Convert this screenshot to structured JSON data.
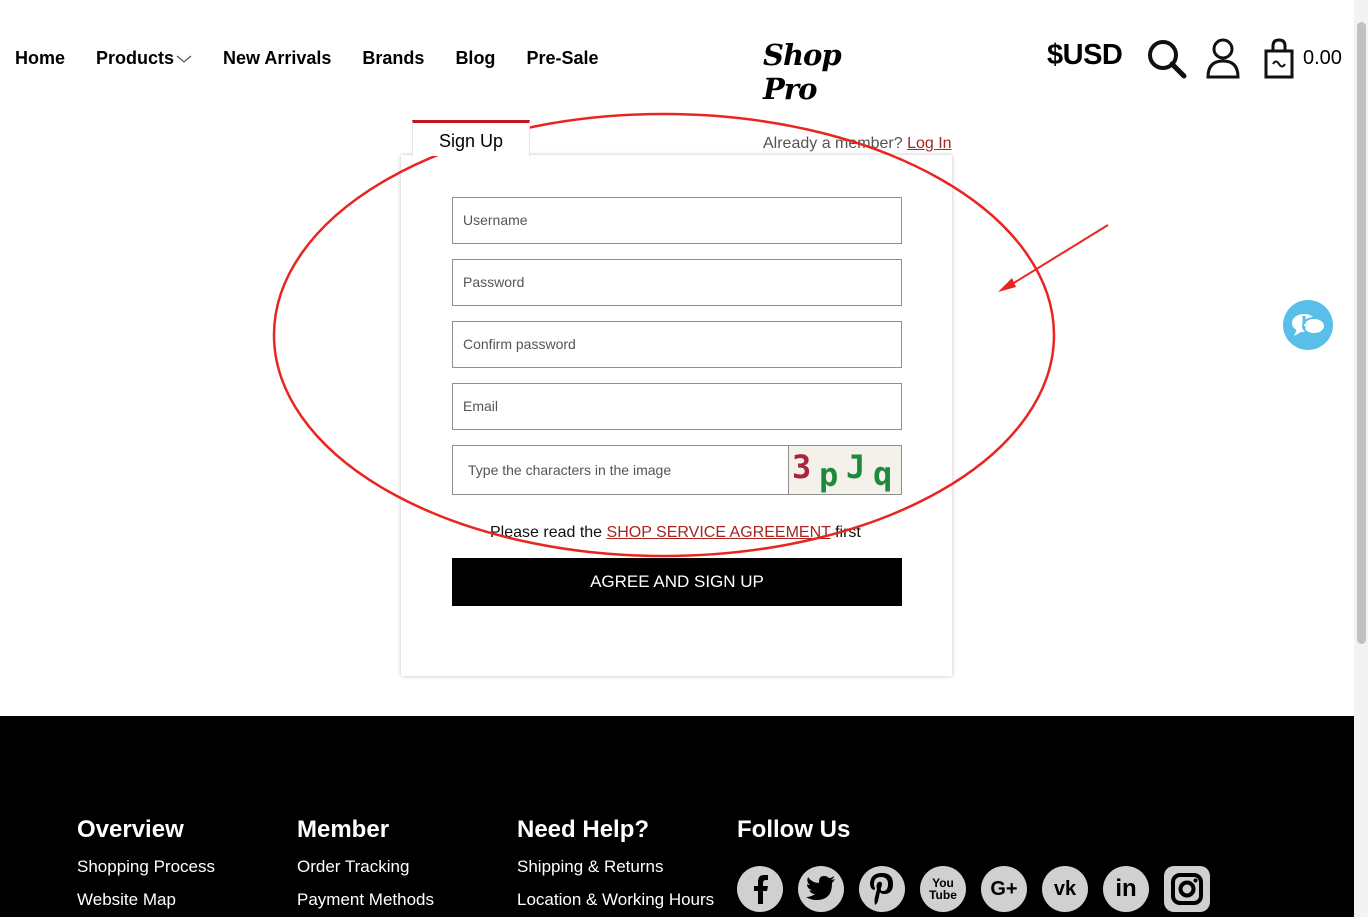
{
  "header": {
    "nav": [
      "Home",
      "Products",
      "New Arrivals",
      "Brands",
      "Blog",
      "Pre-Sale"
    ],
    "logo_text": "Shop Pro",
    "currency": "$USD",
    "cart_total": "0.00"
  },
  "signup": {
    "tab_label": "Sign Up",
    "already_member": "Already a member?",
    "login_link": "Log In",
    "fields": {
      "username": "Username",
      "password": "Password",
      "confirm_password": "Confirm password",
      "email": "Email",
      "captcha": "Type the characters in the image"
    },
    "captcha_chars": [
      "3",
      "p",
      "J",
      "q"
    ],
    "agreement_prefix": "Please read the",
    "agreement_link": "SHOP SERVICE AGREEMENT",
    "agreement_suffix": "first",
    "submit_label": "AGREE AND SIGN UP"
  },
  "footer": {
    "columns": [
      {
        "title": "Overview",
        "links": [
          "Shopping Process",
          "Website Map"
        ]
      },
      {
        "title": "Member",
        "links": [
          "Order Tracking",
          "Payment Methods"
        ]
      },
      {
        "title": "Need Help?",
        "links": [
          "Shipping & Returns",
          "Location & Working Hours"
        ]
      },
      {
        "title": "Follow Us",
        "links": []
      }
    ],
    "social_icons": [
      "facebook-icon",
      "twitter-icon",
      "pinterest-icon",
      "youtube-icon",
      "google-plus-icon",
      "vk-icon",
      "linkedin-icon",
      "instagram-icon"
    ]
  },
  "colors": {
    "accent_red": "#c0181c",
    "link_red": "#a8241e",
    "chat_blue": "#59bfe9",
    "annotation_red": "#e8251f"
  }
}
